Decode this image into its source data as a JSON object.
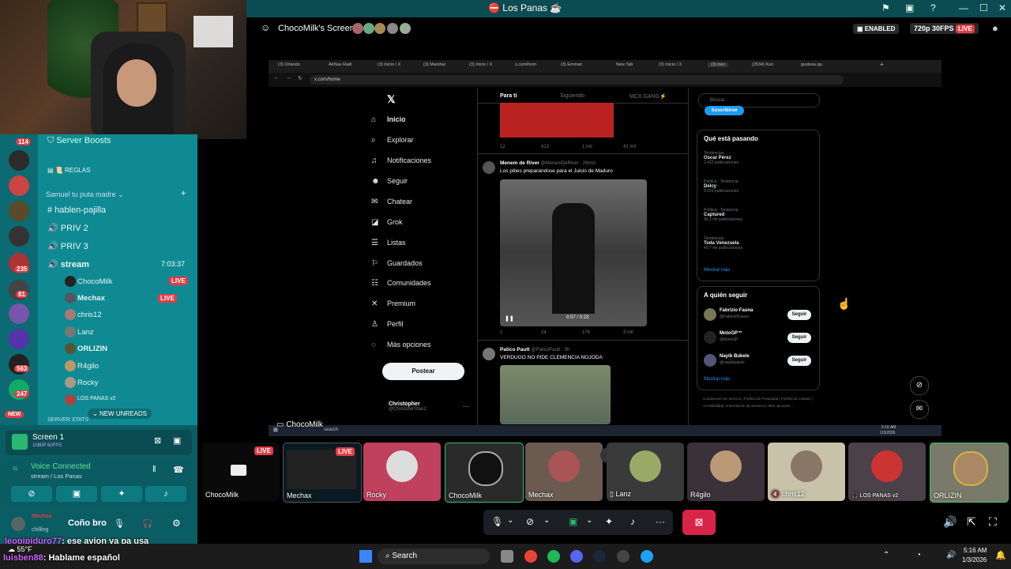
{
  "window": {
    "title": "Los Panas"
  },
  "stream_header": {
    "title": "ChocoMilk's Screen",
    "enabled_badge": "ENABLED",
    "quality": "720p 30FPS",
    "live": "LIVE"
  },
  "browser": {
    "tabs": [
      "(3) Orlando",
      "AirNav Radi",
      "(3) Inicio / X",
      "(3) Marshal",
      "(3) Inicio / X",
      "x.com/hom",
      "(3) Emman",
      "New Tab",
      "(3) Inicio / X",
      "(3) Inici",
      "(2534) Kun",
      "gusteau gu"
    ],
    "url": "x.com/home"
  },
  "x": {
    "nav": [
      "Inicio",
      "Explorar",
      "Notificaciones",
      "Seguir",
      "Chatear",
      "Grok",
      "Listas",
      "Guardados",
      "Comunidades",
      "Premium",
      "Perfil",
      "Más opciones"
    ],
    "post_button": "Postear",
    "account": {
      "name": "Christopher",
      "handle": "@ChristoferSfan2"
    },
    "tabs": {
      "for_you": "Para ti",
      "following": "Siguiendo",
      "other": "MCX GANG⚡"
    },
    "post0": {
      "stats": [
        "12",
        "413",
        "1 mil",
        "41 mil"
      ]
    },
    "post1": {
      "author": "Menem de River",
      "handle": "@MenemDeRiver · 29min",
      "text": "Los pibes preparandose para el Juicio de Maduro",
      "time": "0:07 / 0:23",
      "stats": [
        "1",
        "24",
        "176",
        "3 mil"
      ]
    },
    "post2": {
      "author": "Patico Pautt",
      "handle": "@PaticoPautt · 3h",
      "text": "VERDUGO NO PIDE CLEMENCIA NOJODA"
    },
    "search_placeholder": "Buscar",
    "subscribe": "Suscribirse",
    "trends_title": "Qué está pasando",
    "trends": [
      {
        "cat": "Tendencias",
        "name": "Oscar Pérez",
        "count": "2.422 publicaciones"
      },
      {
        "cat": "Política · Tendencia",
        "name": "Delcy",
        "count": "9.029 publicaciones"
      },
      {
        "cat": "Política · Tendencia",
        "name": "Captured",
        "count": "94,3 mil publicaciones"
      },
      {
        "cat": "Tendencias",
        "name": "Toda Venezuela",
        "count": "49,7 mil publicaciones"
      }
    ],
    "show_more": "Mostrar más",
    "who_title": "A quién seguir",
    "who": [
      {
        "name": "Fabrizio Fauna",
        "handle": "@FabrizioFauna"
      },
      {
        "name": "MotoGP™",
        "handle": "@MotoGP"
      },
      {
        "name": "Nayib Bukele",
        "handle": "@nayibbukele"
      }
    ],
    "follow": "Seguir",
    "show_more2": "Mostrar más",
    "footer": "Condiciones de Servicio | Política de Privacidad | Política de cookies | Accesibilidad | Información de anuncios | Más opciones ..."
  },
  "embedded_taskbar": {
    "search": "search",
    "time": "5:16 AM",
    "date": "1/3/2026"
  },
  "overlay_name": "ChocoMilk",
  "discord": {
    "server_badges": [
      "114",
      "235",
      "81",
      "563",
      "247"
    ],
    "boosts": "Server Boosts",
    "rules": "REGLAS",
    "category": "Samuel tu puta madre",
    "channels": [
      "hablen-pajilla",
      "PRIV 2",
      "PRIV 3"
    ],
    "stream_channel": "stream",
    "stream_timer": "7:03:37",
    "users": [
      "ChocoMilk",
      "Mechax",
      "chris12",
      "Lanz",
      "ORLIZIN",
      "R4gilo",
      "Rocky",
      "LOS PANAS v2"
    ],
    "new_unreads": "NEW UNREADS",
    "new_badge": "NEW",
    "partial_channel": "SERVER STATS",
    "screen": {
      "title": "Screen 1",
      "sub": "1080P 60FPS"
    },
    "voice": {
      "status": "Voice Connected",
      "sub": "stream / Los Panas"
    },
    "me": {
      "name": "Coño bro",
      "top": "Mechax",
      "sub": "chilling"
    }
  },
  "tiles": [
    "ChocoMilk",
    "Mechax",
    "Rocky",
    "ChocoMilk",
    "Mechax",
    "Lanz",
    "R4gilo",
    "chris12",
    "LOS PANAS v2",
    "ORLIZIN"
  ],
  "tile_live": "LIVE",
  "chat": [
    {
      "user": "leopipiduro77",
      "msg": ": ese avion va pa usa"
    },
    {
      "user": "luisben88",
      "msg": ": Hablame español"
    }
  ],
  "weather": "55°F",
  "taskbar": {
    "search": "Search",
    "time": "5:16 AM",
    "date": "1/3/2026"
  },
  "colors": {
    "discord_teal": "#0f8a93",
    "live_red": "#e23c46",
    "x_blue": "#1d9bf0"
  }
}
